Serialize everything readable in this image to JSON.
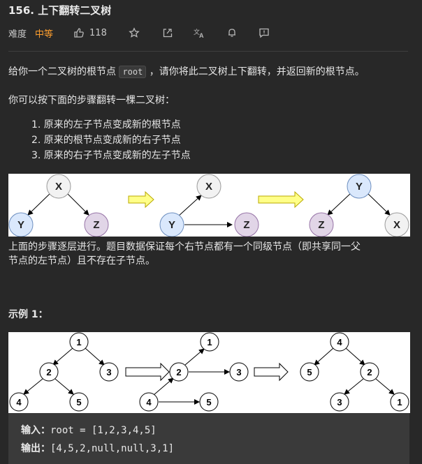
{
  "problem": {
    "title": "156. 上下翻转二叉树",
    "difficulty_label": "难度",
    "difficulty": "中等",
    "likes": "118"
  },
  "description": {
    "p1_before": "给你一个二叉树的根节点 ",
    "p1_code": "root",
    "p1_after": " ，请你将此二叉树上下翻转，并返回新的根节点。",
    "p2": "你可以按下面的步骤翻转一棵二叉树：",
    "steps": [
      "1. 原来的左子节点变成新的根节点",
      "2. 原来的根节点变成新的右子节点",
      "3. 原来的右子节点变成新的左子节点"
    ],
    "p3_line1": "上面的步骤逐层进行。题目数据保证每个右节点都有一个同级节点（即共享同一父",
    "p3_line2": "节点的左节点）且不存在子节点。"
  },
  "diagram1": {
    "nodes": [
      "X",
      "Y",
      "Z"
    ],
    "colors": {
      "x_fill": "#f2f2f2",
      "y_fill": "#dae8fc",
      "z_fill": "#e1d5e7",
      "arrow_fill": "#ffff88",
      "arrow_stroke": "#b8a800"
    }
  },
  "example1": {
    "title": "示例 1：",
    "input_label": "输入：",
    "input_value": "root = [1,2,3,4,5]",
    "output_label": "输出：",
    "output_value": "[4,5,2,null,null,3,1]",
    "tree_values": [
      "1",
      "2",
      "3",
      "4",
      "5"
    ]
  },
  "icons": [
    "thumbs-up-icon",
    "star-icon",
    "share-icon",
    "translate-icon",
    "bell-icon",
    "feedback-icon"
  ]
}
